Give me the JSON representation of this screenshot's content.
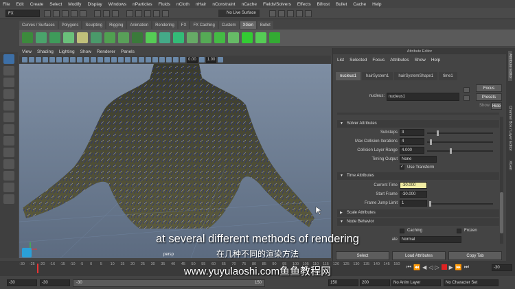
{
  "menubar": [
    "File",
    "Edit",
    "Create",
    "Select",
    "Modify",
    "Display",
    "Windows",
    "nParticles",
    "Fluids",
    "nCloth",
    "nHair",
    "nConstraint",
    "nCache",
    "Fields/Solvers",
    "Effects",
    "Bifrost",
    "Bullet",
    "Cache",
    "Help"
  ],
  "status": {
    "mode": "FX",
    "live_surface": "No Live Surface"
  },
  "shelf_tabs": [
    "Curves / Surfaces",
    "Polygons",
    "Sculpting",
    "Rigging",
    "Animation",
    "Rendering",
    "FX",
    "FX Caching",
    "Custom",
    "XGen",
    "Bullet"
  ],
  "shelf_active": "XGen",
  "viewport": {
    "menu": [
      "View",
      "Shading",
      "Lighting",
      "Show",
      "Renderer",
      "Panels"
    ],
    "near_value": "0.00",
    "far_value": "1.00",
    "camera_label": "persp"
  },
  "attr_editor": {
    "title": "Attribute Editor",
    "menu": [
      "List",
      "Selected",
      "Focus",
      "Attributes",
      "Show",
      "Help"
    ],
    "tabs": [
      "nucleus1",
      "hairSystem1",
      "hairSystemShape1",
      "time1"
    ],
    "active_tab": "nucleus1",
    "node_label": "nucleus:",
    "node_value": "nucleus1",
    "focus_btn": "Focus",
    "presets_btn": "Presets",
    "show_label": "Show",
    "hide_btn": "Hide",
    "solver_section": "Solver Attributes",
    "substeps_label": "Substeps",
    "substeps_value": "3",
    "max_coll_label": "Max Collision Iterations",
    "max_coll_value": "4",
    "coll_layer_label": "Collision Layer Range",
    "coll_layer_value": "4.000",
    "timing_label": "Timing Output",
    "timing_value": "None",
    "use_transform": "Use Transform",
    "time_section": "Time Attributes",
    "current_time_label": "Current Time",
    "current_time_value": "-30.000",
    "start_frame_label": "Start Frame",
    "start_frame_value": "-30.000",
    "frame_jump_label": "Frame Jump Limit",
    "frame_jump_value": "1",
    "scale_section": "Scale Attributes",
    "node_behavior_section": "Node Behavior",
    "caching_label": "Caching",
    "frozen_label": "Frozen",
    "node_state_partial": "ate",
    "node_state_value": "Normal",
    "select_btn": "Select",
    "load_btn": "Load Attributes",
    "copy_btn": "Copy Tab"
  },
  "side_tabs": [
    "Attribute Editor",
    "Channel Box / Layer Editor",
    "XGen"
  ],
  "timeline": {
    "ticks": [
      "-30",
      "-25",
      "-20",
      "-16",
      "-15",
      "-10",
      "-5",
      "0",
      "5",
      "10",
      "15",
      "20",
      "25",
      "30",
      "35",
      "40",
      "45",
      "50",
      "55",
      "60",
      "65",
      "70",
      "75",
      "80",
      "85",
      "90",
      "95",
      "100",
      "105",
      "110",
      "115",
      "120",
      "125",
      "130",
      "135",
      "140",
      "145",
      "150"
    ],
    "current": "-30"
  },
  "range": {
    "start": "-30",
    "inner_start": "-30",
    "inner_end": "150",
    "end_a": "150",
    "end_b": "200",
    "anim_layer": "No Anim Layer",
    "char_set": "No Character Set"
  },
  "subtitles": {
    "en": "at several different methods of rendering",
    "zh": "在几种不同的渲染方法",
    "site": "www.yuyulaoshi.com鱼鱼教程网"
  }
}
